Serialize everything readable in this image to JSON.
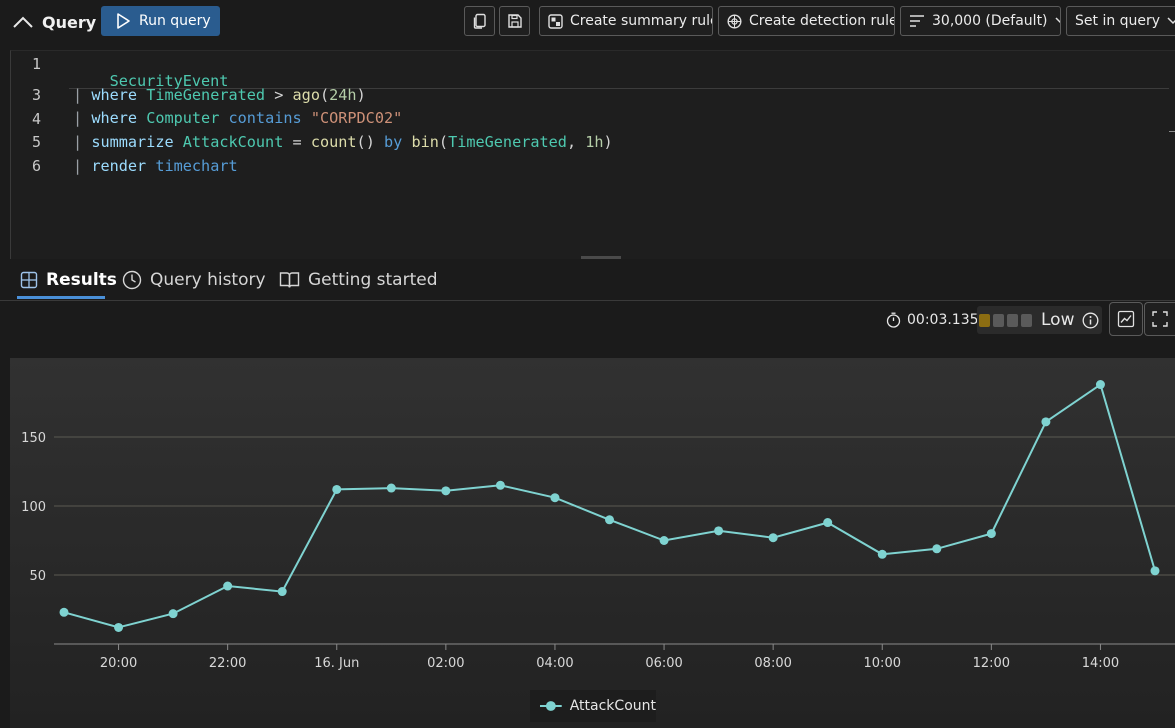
{
  "toolbar": {
    "title": "Query",
    "run_label": "Run query",
    "summary_rule_label": "Create summary rule",
    "detection_rule_label": "Create detection rule",
    "limit_label": "30,000 (Default)",
    "time_label": "Set in query"
  },
  "editor": {
    "lines": [
      {
        "num": "1",
        "text": "SecurityEvent"
      },
      {
        "num": "3",
        "text": "| where TimeGenerated > ago(24h)"
      },
      {
        "num": "4",
        "text": "| where Computer contains \"CORPDC02\""
      },
      {
        "num": "5",
        "text": "| summarize AttackCount = count() by bin(TimeGenerated, 1h)"
      },
      {
        "num": "6",
        "text": "| render timechart"
      }
    ]
  },
  "tabs": [
    {
      "label": "Results",
      "icon": "grid-icon",
      "active": true
    },
    {
      "label": "Query history",
      "icon": "clock-icon",
      "active": false
    },
    {
      "label": "Getting started",
      "icon": "book-icon",
      "active": false
    }
  ],
  "stats": {
    "elapsed": "00:03.135",
    "level": "Low",
    "level_filled": 1,
    "level_total": 4
  },
  "colors": {
    "accent": "#2a5c8f",
    "series": "#7fd3d1",
    "level_on": "#8c6d12",
    "level_off": "#5a5a5a"
  },
  "chart_data": {
    "type": "line",
    "x": [
      "19:00",
      "20:00",
      "21:00",
      "22:00",
      "23:00",
      "16. Jun",
      "01:00",
      "02:00",
      "03:00",
      "04:00",
      "05:00",
      "06:00",
      "07:00",
      "08:00",
      "09:00",
      "10:00",
      "11:00",
      "12:00",
      "13:00",
      "14:00",
      "15:00"
    ],
    "x_tick_labels": [
      "20:00",
      "22:00",
      "16. Jun",
      "02:00",
      "04:00",
      "06:00",
      "08:00",
      "10:00",
      "12:00",
      "14:00"
    ],
    "series": [
      {
        "name": "AttackCount",
        "values": [
          23,
          12,
          22,
          42,
          38,
          112,
          113,
          111,
          115,
          106,
          90,
          75,
          82,
          77,
          88,
          65,
          69,
          80,
          161,
          188,
          53
        ]
      }
    ],
    "y_ticks": [
      50,
      100,
      150
    ],
    "ylim": [
      0,
      200
    ],
    "grid": true,
    "legend": "bottom-center"
  }
}
